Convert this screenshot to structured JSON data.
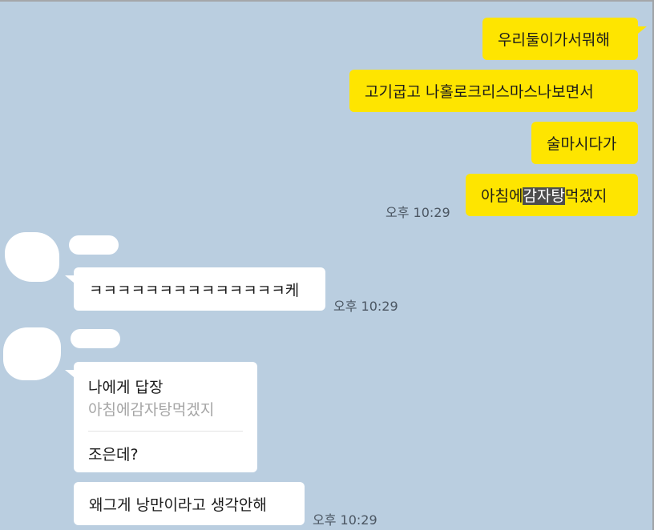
{
  "colors": {
    "background": "#bacee0",
    "my_bubble": "#fee500",
    "their_bubble": "#ffffff",
    "timestamp": "#4b5662",
    "quote_text": "#a5a5a5"
  },
  "messages": {
    "m1": "우리둘이가서뭐해",
    "m2": "고기굽고 나홀로크리스마스나보면서",
    "m3": "술마시다가",
    "m4": {
      "before": "아침에",
      "highlight": "감자탕",
      "after": "먹겠지"
    },
    "t1": "ㅋㅋㅋㅋㅋㅋㅋㅋㅋㅋㅋㅋㅋㅋ케",
    "t2": {
      "reply_title": "나에게 답장",
      "quoted": "아침에감자탕먹겠지",
      "text": "조은데?"
    },
    "t3": "왜그게 낭만이라고 생각안해"
  },
  "timestamps": {
    "me_last": "오후 10:29",
    "them_first": "오후 10:29",
    "them_last": "오후 10:29"
  }
}
